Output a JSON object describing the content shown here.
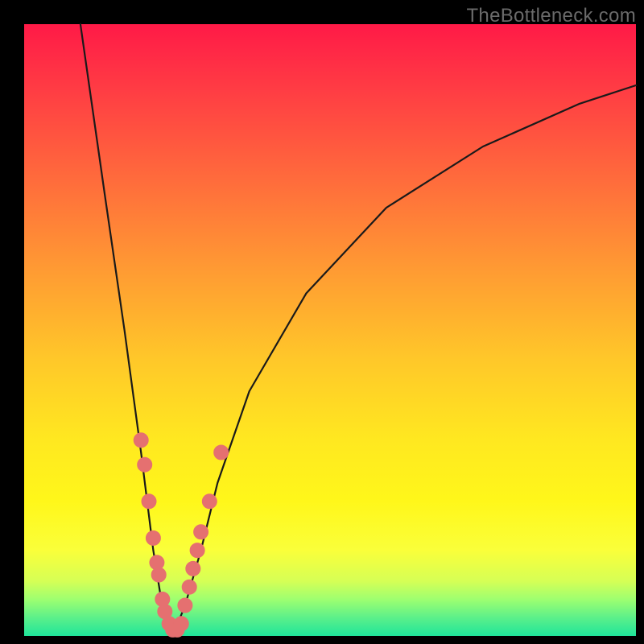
{
  "watermark": "TheBottleneck.com",
  "colors": {
    "frame": "#000000",
    "watermark_text": "#6a6a6a",
    "gradient_top": "#ff1a47",
    "gradient_bottom": "#1fe59a",
    "curve_stroke": "#1a1a1a",
    "marker_fill": "#e57070",
    "marker_stroke": "#e57070"
  },
  "chart_data": {
    "type": "line",
    "title": "",
    "xlabel": "",
    "ylabel": "",
    "xlim": [
      0,
      100
    ],
    "ylim": [
      0,
      100
    ],
    "note": "Axes are unlabeled; x is horizontal distance left→right, y is height bottom→top, both as % of plot area. Curve is a V-shaped bottleneck profile. Values read from pixel positions.",
    "series": [
      {
        "name": "bottleneck-curve-left",
        "x": [
          9.2,
          13.2,
          16.4,
          19.1,
          21.1,
          22.4,
          23.0,
          24.3
        ],
        "y": [
          100,
          72,
          50,
          30,
          14,
          6,
          3,
          0
        ]
      },
      {
        "name": "bottleneck-curve-right",
        "x": [
          24.3,
          26.3,
          28.9,
          31.6,
          36.8,
          46.1,
          59.2,
          75.0,
          90.8,
          100
        ],
        "y": [
          0,
          5,
          14,
          25,
          40,
          56,
          70,
          80,
          87,
          90
        ]
      }
    ],
    "markers": {
      "name": "highlighted-points",
      "note": "Pink dot clusters near the valley on both branches",
      "points": [
        {
          "x": 19.1,
          "y": 32
        },
        {
          "x": 19.7,
          "y": 28
        },
        {
          "x": 20.4,
          "y": 22
        },
        {
          "x": 21.1,
          "y": 16
        },
        {
          "x": 21.7,
          "y": 12
        },
        {
          "x": 22.0,
          "y": 10
        },
        {
          "x": 22.6,
          "y": 6
        },
        {
          "x": 23.0,
          "y": 4
        },
        {
          "x": 23.7,
          "y": 2
        },
        {
          "x": 24.3,
          "y": 1
        },
        {
          "x": 25.0,
          "y": 1
        },
        {
          "x": 25.7,
          "y": 2
        },
        {
          "x": 26.3,
          "y": 5
        },
        {
          "x": 27.0,
          "y": 8
        },
        {
          "x": 27.6,
          "y": 11
        },
        {
          "x": 28.3,
          "y": 14
        },
        {
          "x": 28.9,
          "y": 17
        },
        {
          "x": 30.3,
          "y": 22
        },
        {
          "x": 32.2,
          "y": 30
        }
      ]
    }
  }
}
